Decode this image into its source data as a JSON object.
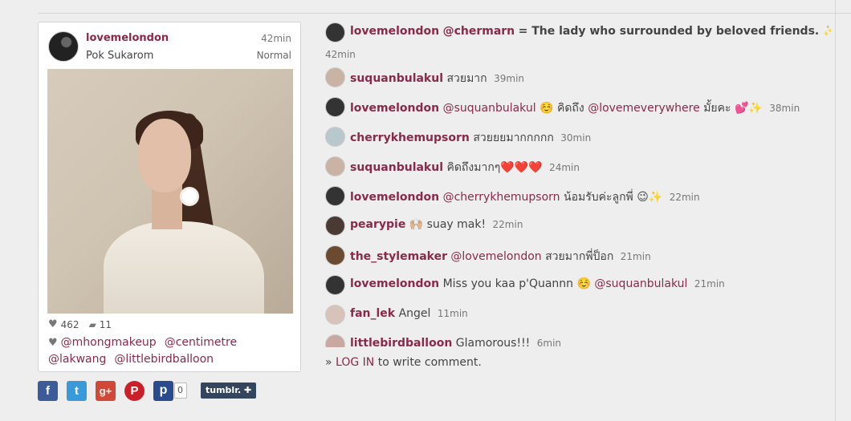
{
  "post": {
    "username": "lovemelondon",
    "time": "42min",
    "location": "Pok Sukarom",
    "filter": "Normal",
    "likes": "462",
    "comments_count": "11",
    "tags": [
      "@mhongmakeup",
      "@centimetre",
      "@lakwang",
      "@littlebirdballoon"
    ]
  },
  "share": {
    "facebook": "f",
    "twitter": "t",
    "googleplus": "g+",
    "pinterest": "P",
    "pinme": "p",
    "pin_count": "0",
    "tumblr": "tumblr. ✚"
  },
  "caption": {
    "username": "lovemelondon",
    "mention": "@chermarn",
    "text": "= The lady who surrounded by beloved friends. ✨",
    "time": "42min"
  },
  "comments": [
    {
      "username": "suquanbulakul",
      "text": "สวยมาก",
      "time": "39min",
      "avatar_color": "#c9b3a4"
    },
    {
      "username": "lovemelondon",
      "mention": "@suquanbulakul",
      "text": "☺️ คิดถึง",
      "mention2": "@lovemeverywhere",
      "text2": "มั้ยคะ 💕✨",
      "time": "38min",
      "avatar_color": "#333333"
    },
    {
      "username": "cherrykhemupsorn",
      "text": "สวยยยมากกกกก",
      "time": "30min",
      "avatar_color": "#b8c8cc"
    },
    {
      "username": "suquanbulakul",
      "text": "คิดถึงมากๆ❤️❤️❤️",
      "time": "24min",
      "avatar_color": "#c9b3a4"
    },
    {
      "username": "lovemelondon",
      "mention": "@cherrykhemupsorn",
      "text": "น้อมรับค่ะลูกพี่ 😉✨",
      "time": "22min",
      "avatar_color": "#333333"
    },
    {
      "username": "pearypie",
      "text": "🙌🏼 suay mak!",
      "time": "22min",
      "avatar_color": "#4a3a34"
    },
    {
      "username": "the_stylemaker",
      "mention": "@lovemelondon",
      "text": "สวยมากพี่ป็อก",
      "time": "21min",
      "avatar_color": "#6a4a30"
    },
    {
      "username": "lovemelondon",
      "text": "Miss you kaa p'Quannn ☺️",
      "mention": "@suquanbulakul",
      "time": "21min",
      "avatar_color": "#333333"
    },
    {
      "username": "fan_lek",
      "text": "Angel",
      "time": "11min",
      "avatar_color": "#d8c3bb"
    },
    {
      "username": "littlebirdballoon",
      "text": "Glamorous!!!",
      "time": "6min",
      "avatar_color": "#c8a8a0"
    }
  ],
  "login": {
    "arrow": "»",
    "link": "LOG IN",
    "text": "to write comment."
  }
}
